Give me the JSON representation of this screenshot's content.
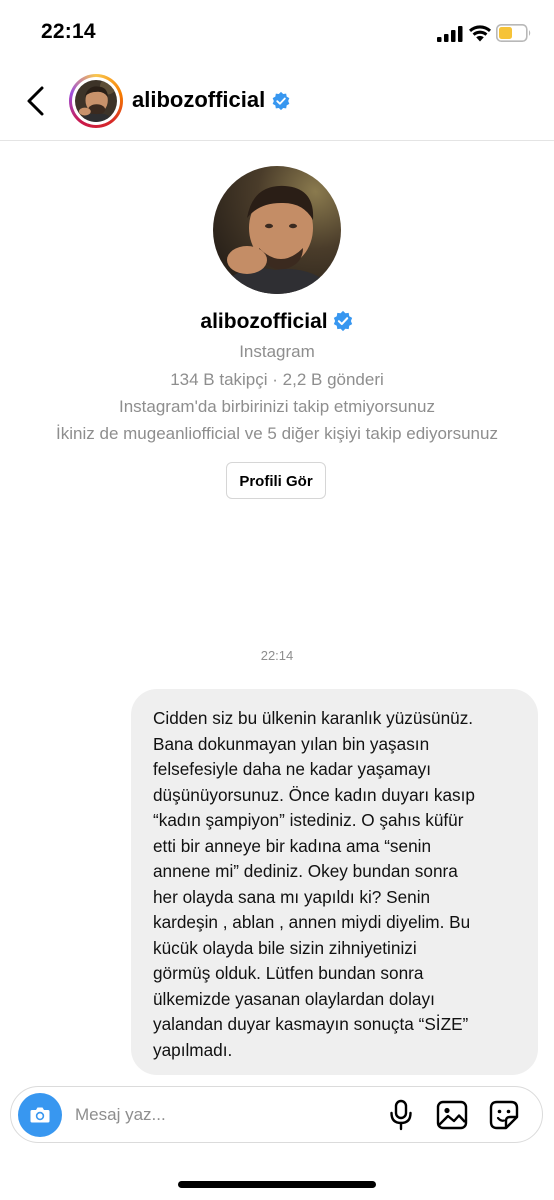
{
  "status_bar": {
    "time": "22:14"
  },
  "header": {
    "username": "alibozofficial"
  },
  "profile": {
    "username": "alibozofficial",
    "source": "Instagram",
    "stats": "134 B takipçi · 2,2 B gönderi",
    "follow_status": "Instagram'da birbirinizi takip etmiyorsunuz",
    "mutual": "İkiniz de mugeanliofficial ve 5 diğer kişiyi takip ediyorsunuz",
    "view_profile_label": "Profili Gör"
  },
  "conversation": {
    "timestamp": "22:14",
    "message_lines": [
      "Cidden siz bu ülkenin karanlık yüzüsünüz.",
      "Bana dokunmayan yılan bin yaşasın",
      "felsefesiyle daha ne kadar yaşamayı",
      "düşünüyorsunuz. Önce kadın duyarı kasıp",
      "“kadın şampiyon” istediniz. O şahıs küfür",
      "etti bir anneye bir kadına ama “senin",
      "annene mi” dediniz. Okey bundan sonra",
      "her olayda sana mı yapıldı ki? Senin",
      "kardeşin , ablan , annen miydi diyelim. Bu",
      "kücük olayda bile sizin zihniyetinizi",
      "görmüş olduk. Lütfen bundan sonra",
      "ülkemizde yasanan olaylardan dolayı",
      "yalandan duyar kasmayın sonuçta “SİZE”",
      "yapılmadı."
    ]
  },
  "composer": {
    "placeholder": "Mesaj yaz..."
  },
  "icons": {
    "back": "chevron-left-icon",
    "verified": "verified-badge-icon",
    "camera": "camera-icon",
    "mic": "microphone-icon",
    "gallery": "image-icon",
    "sticker": "sticker-icon"
  },
  "colors": {
    "verified_blue": "#3897f0",
    "bubble_gray": "#efefef",
    "secondary_text": "#8e8e8e",
    "battery_yellow": "#f6c338"
  }
}
